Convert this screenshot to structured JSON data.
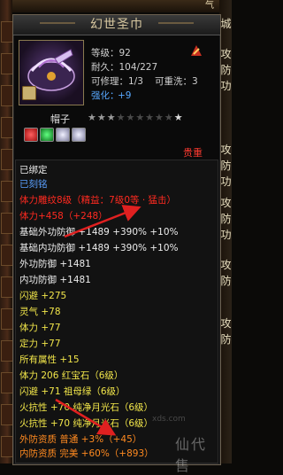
{
  "topbar": {
    "right_label": "气"
  },
  "sidebar_right": [
    "城",
    "攻",
    "防",
    "功",
    "攻",
    "防",
    "功",
    "攻",
    "防",
    "功",
    "攻",
    "防",
    "攻",
    "防"
  ],
  "panel": {
    "title": "幻世圣巾",
    "stats": {
      "level": "等级：92",
      "durability": "耐久：104/227",
      "repairable": "可修理：1/3",
      "rewash": "可重洗：3",
      "enhance_label": "强化：",
      "enhance_value": "+9"
    },
    "item_type": "帽子",
    "stars_lit": "★★★",
    "stars_dim": "★★★★★★",
    "stars_end": "★",
    "grade": "贵重",
    "info_lines": [
      {
        "text": "已绑定",
        "color": "white"
      },
      {
        "text": "已刻铭",
        "color": "blue"
      },
      {
        "text": "体力雕纹8级（精益：7级0等 · 猛击）",
        "color": "red"
      },
      {
        "text": "体力+458（+248）",
        "color": "red"
      },
      {
        "text": "基础外功防御 +1489 +390% +10%",
        "color": "white"
      },
      {
        "text": "基础内功防御 +1489 +390% +10%",
        "color": "white"
      },
      {
        "text": "外功防御 +1481",
        "color": "white"
      },
      {
        "text": "内功防御 +1481",
        "color": "white"
      },
      {
        "text": "闪避 +275",
        "color": "yellow"
      },
      {
        "text": "灵气 +78",
        "color": "yellow"
      },
      {
        "text": "体力 +77",
        "color": "yellow"
      },
      {
        "text": "定力 +77",
        "color": "yellow"
      },
      {
        "text": "所有属性 +15",
        "color": "yellow"
      },
      {
        "text": "体力 206 红宝石（6级）",
        "color": "yellow"
      },
      {
        "text": "闪避 +71 祖母绿（6级）",
        "color": "yellow"
      },
      {
        "text": "火抗性 +70 纯净月光石（6级）",
        "color": "yellow"
      },
      {
        "text": "火抗性 +70 纯净月光石（6级）",
        "color": "yellow"
      },
      {
        "text": "外防资质 普通 +3%（+45）",
        "color": "orange"
      },
      {
        "text": "内防资质 完美 +60%（+893）",
        "color": "orange"
      }
    ]
  },
  "watermark": {
    "text": "仙代售",
    "url": "xds.com"
  },
  "colors": {
    "red": "#ff2a20",
    "blue": "#5aa0ff",
    "yellow": "#f2e64a",
    "orange": "#ff8a20",
    "white": "#ececec"
  }
}
